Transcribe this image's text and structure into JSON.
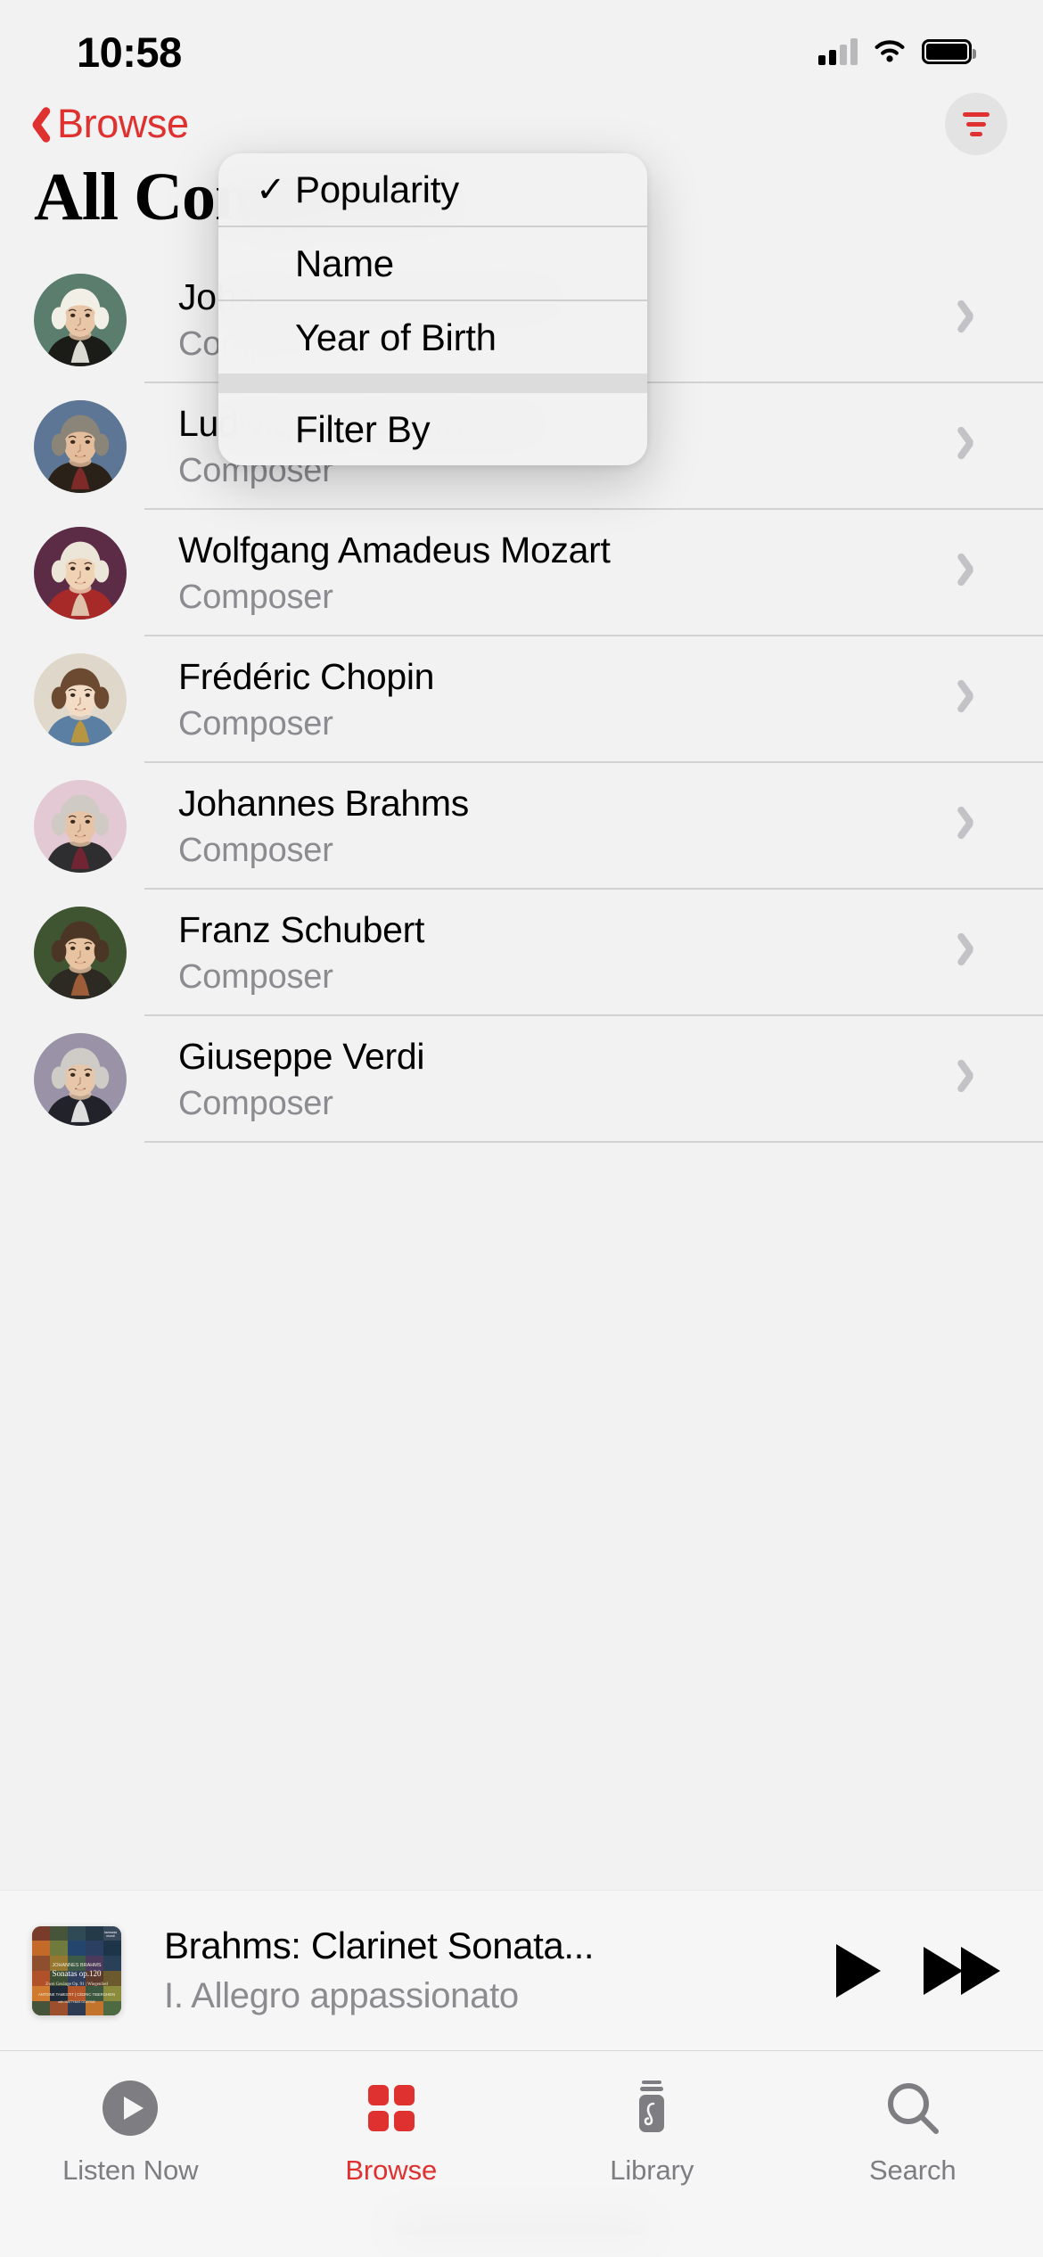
{
  "status_bar": {
    "time": "10:58",
    "cellular_icon": "cellular-signal-icon",
    "wifi_icon": "wifi-icon",
    "battery_icon": "battery-icon"
  },
  "nav": {
    "back_label": "Browse",
    "back_icon": "chevron-left-icon",
    "filter_icon": "sort-filter-icon"
  },
  "page": {
    "title": "All Composers"
  },
  "sort_menu": {
    "visible": true,
    "checkmark": "✓",
    "items": [
      {
        "label": "Popularity",
        "checked": true,
        "name": "menu-item-popularity"
      },
      {
        "label": "Name",
        "checked": false,
        "name": "menu-item-name"
      },
      {
        "label": "Year of Birth",
        "checked": false,
        "name": "menu-item-year-of-birth"
      },
      {
        "label": "Filter By",
        "checked": false,
        "name": "menu-item-filter-by"
      }
    ]
  },
  "list": {
    "subtitle_default": "Composer",
    "chevron_icon": "chevron-right-icon",
    "rows": [
      {
        "name": "Johann Sebastian Bach",
        "subtitle": "Composer",
        "avatar": "portrait-bach",
        "bg": "#5b7d6e",
        "skin": "#e8c6a8",
        "hair": "#f2f0e6",
        "coat": "#1b1b17",
        "accent": "#fdfcf5"
      },
      {
        "name": "Ludwig van Beethoven",
        "subtitle": "Composer",
        "avatar": "portrait-beethoven",
        "bg": "#5d7696",
        "skin": "#e3bd9c",
        "hair": "#8b8579",
        "coat": "#2a2118",
        "accent": "#8c2b2b"
      },
      {
        "name": "Wolfgang Amadeus Mozart",
        "subtitle": "Composer",
        "avatar": "portrait-mozart",
        "bg": "#5c2b46",
        "skin": "#f0d2b5",
        "hair": "#ece6d8",
        "coat": "#a72a28",
        "accent": "#e9dcc0"
      },
      {
        "name": "Frédéric Chopin",
        "subtitle": "Composer",
        "avatar": "portrait-chopin",
        "bg": "#dfd8cb",
        "skin": "#f2dcc6",
        "hair": "#6b4a31",
        "coat": "#5b7fa3",
        "accent": "#c79a33"
      },
      {
        "name": "Johannes Brahms",
        "subtitle": "Composer",
        "avatar": "portrait-brahms",
        "bg": "#e3c9d4",
        "skin": "#e8c4a6",
        "hair": "#cfcac4",
        "coat": "#2e2e30",
        "accent": "#7d2333"
      },
      {
        "name": "Franz Schubert",
        "subtitle": "Composer",
        "avatar": "portrait-schubert",
        "bg": "#3f5431",
        "skin": "#e8c3a2",
        "hair": "#4b3524",
        "coat": "#2c2a22",
        "accent": "#b0663c"
      },
      {
        "name": "Giuseppe Verdi",
        "subtitle": "Composer",
        "avatar": "portrait-verdi",
        "bg": "#9a93a8",
        "skin": "#e6c7aa",
        "hair": "#cfcbc6",
        "coat": "#22222a",
        "accent": "#ffffff"
      }
    ]
  },
  "mini_player": {
    "title": "Brahms: Clarinet Sonata...",
    "subtitle": "I. Allegro appassionato",
    "play_icon": "play-icon",
    "forward_icon": "fast-forward-icon",
    "artwork": {
      "name": "album-artwork-brahms-sonatas",
      "label_line1": "JOHANNES BRAHMS",
      "label_line2": "Sonatas op.120",
      "label_line3": "Zwei Gesänge Op. 91 | Wiegenlied",
      "label_line4": "ANTOINE TAMESTIT | CÉDRIC TIBERGHIEN",
      "label_line5": "with MATTHIAS GOERNE",
      "imprint": "harmonia mundi"
    }
  },
  "tab_bar": {
    "tabs": [
      {
        "label": "Listen Now",
        "icon": "play-circle-icon",
        "active": false,
        "name": "tab-listen-now"
      },
      {
        "label": "Browse",
        "icon": "grid-squares-icon",
        "active": true,
        "name": "tab-browse"
      },
      {
        "label": "Library",
        "icon": "library-jar-icon",
        "active": false,
        "name": "tab-library"
      },
      {
        "label": "Search",
        "icon": "search-icon",
        "active": false,
        "name": "tab-search"
      }
    ],
    "accent_color": "#e03131",
    "inactive_color": "#7d7d82"
  }
}
